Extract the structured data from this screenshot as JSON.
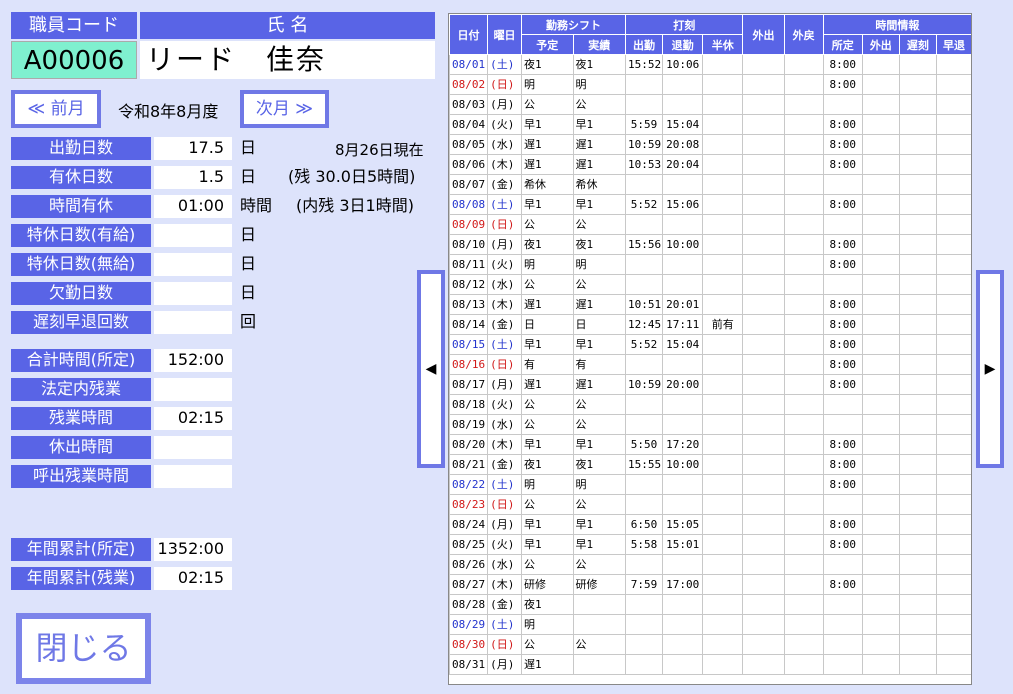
{
  "header": {
    "emp_code_label": "職員コード",
    "name_label": "氏 名",
    "emp_code": "A00006",
    "emp_name": "リード　佳奈"
  },
  "nav": {
    "prev_label": "≪ 前月",
    "next_label": "次月 ≫",
    "month": "令和8年8月度",
    "as_of": "8月26日現在"
  },
  "summary": {
    "work_days": {
      "label": "出勤日数",
      "value": "17.5",
      "unit": "日"
    },
    "paid_leave": {
      "label": "有休日数",
      "value": "1.5",
      "unit": "日",
      "note": "(残 30.0日5時間)"
    },
    "hourly_leave": {
      "label": "時間有休",
      "value": "01:00",
      "unit": "時間",
      "note": "(内残 3日1時間)"
    },
    "special_paid": {
      "label": "特休日数(有給)",
      "value": "",
      "unit": "日"
    },
    "special_unpaid": {
      "label": "特休日数(無給)",
      "value": "",
      "unit": "日"
    },
    "absence": {
      "label": "欠勤日数",
      "value": "",
      "unit": "日"
    },
    "late_early": {
      "label": "遅刻早退回数",
      "value": "",
      "unit": "回"
    },
    "total_hours": {
      "label": "合計時間(所定)",
      "value": "152:00"
    },
    "legal_ot": {
      "label": "法定内残業",
      "value": ""
    },
    "overtime": {
      "label": "残業時間",
      "value": "02:15"
    },
    "holiday_work": {
      "label": "休出時間",
      "value": ""
    },
    "callout_ot": {
      "label": "呼出残業時間",
      "value": ""
    },
    "annual_std": {
      "label": "年間累計(所定)",
      "value": "1352:00"
    },
    "annual_ot": {
      "label": "年間累計(残業)",
      "value": "02:15"
    }
  },
  "close_label": "閉じる",
  "arrows": {
    "left": "◀",
    "right": "▶"
  },
  "table": {
    "headers": {
      "date": "日付",
      "dow": "曜日",
      "shift": "勤務シフト",
      "stamp": "打刻",
      "out": "外出",
      "back": "外戻",
      "time_info": "時間情報",
      "plan": "予定",
      "actual": "実績",
      "clock_in": "出勤",
      "clock_out": "退勤",
      "half": "半休",
      "std": "所定",
      "go_out": "外出",
      "late": "遅刻",
      "early": "早退"
    },
    "rows": [
      {
        "date": "08/01",
        "dow": "(土)",
        "type": "sat",
        "plan": "夜1",
        "actual": "夜1",
        "in": "15:52",
        "out": "10:06",
        "half": "",
        "std": "8:00"
      },
      {
        "date": "08/02",
        "dow": "(日)",
        "type": "sun",
        "plan": "明",
        "actual": "明",
        "in": "",
        "out": "",
        "half": "",
        "std": "8:00"
      },
      {
        "date": "08/03",
        "dow": "(月)",
        "type": "",
        "plan": "公",
        "actual": "公",
        "in": "",
        "out": "",
        "half": "",
        "std": ""
      },
      {
        "date": "08/04",
        "dow": "(火)",
        "type": "",
        "plan": "早1",
        "actual": "早1",
        "in": "5:59",
        "out": "15:04",
        "half": "",
        "std": "8:00"
      },
      {
        "date": "08/05",
        "dow": "(水)",
        "type": "",
        "plan": "遅1",
        "actual": "遅1",
        "in": "10:59",
        "out": "20:08",
        "half": "",
        "std": "8:00"
      },
      {
        "date": "08/06",
        "dow": "(木)",
        "type": "",
        "plan": "遅1",
        "actual": "遅1",
        "in": "10:53",
        "out": "20:04",
        "half": "",
        "std": "8:00"
      },
      {
        "date": "08/07",
        "dow": "(金)",
        "type": "",
        "plan": "希休",
        "actual": "希休",
        "in": "",
        "out": "",
        "half": "",
        "std": ""
      },
      {
        "date": "08/08",
        "dow": "(土)",
        "type": "sat",
        "plan": "早1",
        "actual": "早1",
        "in": "5:52",
        "out": "15:06",
        "half": "",
        "std": "8:00"
      },
      {
        "date": "08/09",
        "dow": "(日)",
        "type": "sun",
        "plan": "公",
        "actual": "公",
        "in": "",
        "out": "",
        "half": "",
        "std": ""
      },
      {
        "date": "08/10",
        "dow": "(月)",
        "type": "",
        "plan": "夜1",
        "actual": "夜1",
        "in": "15:56",
        "out": "10:00",
        "half": "",
        "std": "8:00"
      },
      {
        "date": "08/11",
        "dow": "(火)",
        "type": "",
        "plan": "明",
        "actual": "明",
        "in": "",
        "out": "",
        "half": "",
        "std": "8:00"
      },
      {
        "date": "08/12",
        "dow": "(水)",
        "type": "",
        "plan": "公",
        "actual": "公",
        "in": "",
        "out": "",
        "half": "",
        "std": ""
      },
      {
        "date": "08/13",
        "dow": "(木)",
        "type": "",
        "plan": "遅1",
        "actual": "遅1",
        "in": "10:51",
        "out": "20:01",
        "half": "",
        "std": "8:00"
      },
      {
        "date": "08/14",
        "dow": "(金)",
        "type": "",
        "plan": "日",
        "actual": "日",
        "in": "12:45",
        "out": "17:11",
        "half": "前有",
        "std": "8:00"
      },
      {
        "date": "08/15",
        "dow": "(土)",
        "type": "sat",
        "plan": "早1",
        "actual": "早1",
        "in": "5:52",
        "out": "15:04",
        "half": "",
        "std": "8:00"
      },
      {
        "date": "08/16",
        "dow": "(日)",
        "type": "sun",
        "plan": "有",
        "actual": "有",
        "in": "",
        "out": "",
        "half": "",
        "std": "8:00"
      },
      {
        "date": "08/17",
        "dow": "(月)",
        "type": "",
        "plan": "遅1",
        "actual": "遅1",
        "in": "10:59",
        "out": "20:00",
        "half": "",
        "std": "8:00"
      },
      {
        "date": "08/18",
        "dow": "(火)",
        "type": "",
        "plan": "公",
        "actual": "公",
        "in": "",
        "out": "",
        "half": "",
        "std": ""
      },
      {
        "date": "08/19",
        "dow": "(水)",
        "type": "",
        "plan": "公",
        "actual": "公",
        "in": "",
        "out": "",
        "half": "",
        "std": ""
      },
      {
        "date": "08/20",
        "dow": "(木)",
        "type": "",
        "plan": "早1",
        "actual": "早1",
        "in": "5:50",
        "out": "17:20",
        "half": "",
        "std": "8:00"
      },
      {
        "date": "08/21",
        "dow": "(金)",
        "type": "",
        "plan": "夜1",
        "actual": "夜1",
        "in": "15:55",
        "out": "10:00",
        "half": "",
        "std": "8:00"
      },
      {
        "date": "08/22",
        "dow": "(土)",
        "type": "sat",
        "plan": "明",
        "actual": "明",
        "in": "",
        "out": "",
        "half": "",
        "std": "8:00"
      },
      {
        "date": "08/23",
        "dow": "(日)",
        "type": "sun",
        "plan": "公",
        "actual": "公",
        "in": "",
        "out": "",
        "half": "",
        "std": ""
      },
      {
        "date": "08/24",
        "dow": "(月)",
        "type": "",
        "plan": "早1",
        "actual": "早1",
        "in": "6:50",
        "out": "15:05",
        "half": "",
        "std": "8:00"
      },
      {
        "date": "08/25",
        "dow": "(火)",
        "type": "",
        "plan": "早1",
        "actual": "早1",
        "in": "5:58",
        "out": "15:01",
        "half": "",
        "std": "8:00"
      },
      {
        "date": "08/26",
        "dow": "(水)",
        "type": "",
        "plan": "公",
        "actual": "公",
        "in": "",
        "out": "",
        "half": "",
        "std": ""
      },
      {
        "date": "08/27",
        "dow": "(木)",
        "type": "",
        "plan": "研修",
        "actual": "研修",
        "in": "7:59",
        "out": "17:00",
        "half": "",
        "std": "8:00"
      },
      {
        "date": "08/28",
        "dow": "(金)",
        "type": "",
        "plan": "夜1",
        "actual": "",
        "in": "",
        "out": "",
        "half": "",
        "std": ""
      },
      {
        "date": "08/29",
        "dow": "(土)",
        "type": "sat",
        "plan": "明",
        "actual": "",
        "in": "",
        "out": "",
        "half": "",
        "std": ""
      },
      {
        "date": "08/30",
        "dow": "(日)",
        "type": "sun",
        "plan": "公",
        "actual": "公",
        "in": "",
        "out": "",
        "half": "",
        "std": ""
      },
      {
        "date": "08/31",
        "dow": "(月)",
        "type": "",
        "plan": "遅1",
        "actual": "",
        "in": "",
        "out": "",
        "half": "",
        "std": ""
      }
    ]
  }
}
